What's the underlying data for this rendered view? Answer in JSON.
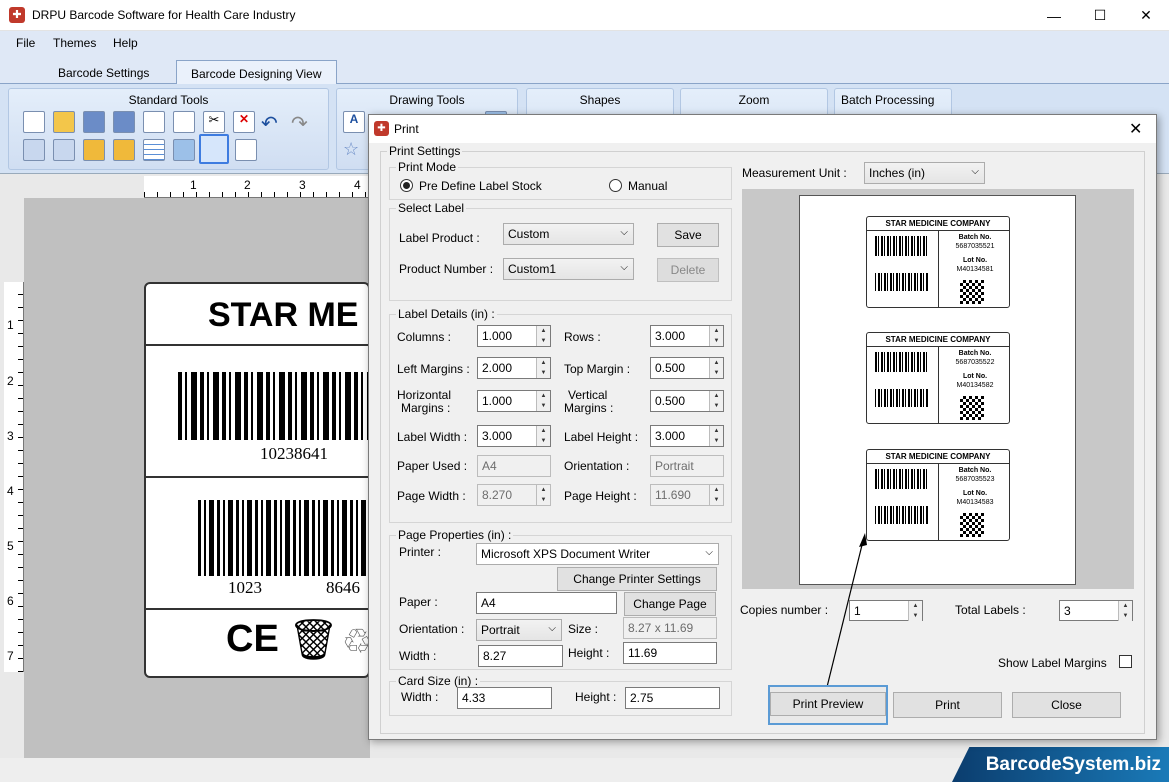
{
  "app": {
    "title": "DRPU Barcode Software for Health Care Industry"
  },
  "menu": [
    "File",
    "Themes",
    "Help"
  ],
  "tabs": [
    "Barcode Settings",
    "Barcode Designing View"
  ],
  "ribbon": {
    "groups": [
      "Standard Tools",
      "Drawing Tools",
      "Shapes",
      "Zoom",
      "Batch Processing"
    ]
  },
  "canvas": {
    "hruler": [
      "1",
      "2",
      "3",
      "4"
    ],
    "vruler": [
      "1",
      "2",
      "3",
      "4",
      "5",
      "6",
      "7"
    ],
    "label_title": "STAR ME",
    "barcode1": "10238641",
    "barcode2_left": "1023",
    "barcode2_right": "8646",
    "ce": "CE"
  },
  "brand": "BarcodeSystem.biz",
  "dialog": {
    "title": "Print",
    "print_settings": "Print Settings",
    "print_mode": {
      "legend": "Print Mode",
      "opt1": "Pre Define Label Stock",
      "opt2": "Manual"
    },
    "select_label": {
      "legend": "Select Label",
      "product_label": "Label Product :",
      "product_value": "Custom",
      "save": "Save",
      "number_label": "Product Number :",
      "number_value": "Custom1",
      "delete": "Delete"
    },
    "label_details": {
      "legend": "Label Details (in) :",
      "columns_l": "Columns :",
      "columns": "1.000",
      "rows_l": "Rows :",
      "rows": "3.000",
      "lmargin_l": "Left Margins :",
      "lmargin": "2.000",
      "tmargin_l": "Top Margin :",
      "tmargin": "0.500",
      "hmargin_l1": "Horizontal",
      "hmargin_l2": "Margins :",
      "hmargin": "1.000",
      "vmargin_l1": "Vertical",
      "vmargin_l2": "Margins :",
      "vmargin": "0.500",
      "lwidth_l": "Label Width :",
      "lwidth": "3.000",
      "lheight_l": "Label Height :",
      "lheight": "3.000",
      "paper_l": "Paper Used :",
      "paper": "A4",
      "orient_l": "Orientation :",
      "orient": "Portrait",
      "pwidth_l": "Page Width :",
      "pwidth": "8.270",
      "pheight_l": "Page Height :",
      "pheight": "11.690"
    },
    "page_props": {
      "legend": "Page Properties (in) :",
      "printer_l": "Printer :",
      "printer": "Microsoft XPS Document Writer",
      "change_printer": "Change Printer Settings",
      "paper_l": "Paper :",
      "paper": "A4",
      "change_page": "Change Page",
      "orient_l": "Orientation :",
      "orient": "Portrait",
      "size_l": "Size :",
      "size": "8.27 x 11.69",
      "width_l": "Width :",
      "width": "8.27",
      "height_l": "Height :",
      "height": "11.69"
    },
    "card_size": {
      "legend": "Card Size (in) :",
      "width_l": "Width :",
      "width": "4.33",
      "height_l": "Height :",
      "height": "2.75"
    },
    "measurement_l": "Measurement Unit :",
    "measurement": "Inches (in)",
    "copies_l": "Copies number :",
    "copies": "1",
    "total_l": "Total Labels :",
    "total": "3",
    "show_margins": "Show Label Margins",
    "buttons": {
      "preview": "Print Preview",
      "print": "Print",
      "close": "Close"
    },
    "preview_labels": [
      {
        "company": "STAR MEDICINE COMPANY",
        "batch_l": "Batch No.",
        "batch": "5687035521",
        "lot_l": "Lot No.",
        "lot": "M40134581"
      },
      {
        "company": "STAR MEDICINE COMPANY",
        "batch_l": "Batch No.",
        "batch": "5687035522",
        "lot_l": "Lot No.",
        "lot": "M40134582"
      },
      {
        "company": "STAR MEDICINE COMPANY",
        "batch_l": "Batch No.",
        "batch": "5687035523",
        "lot_l": "Lot No.",
        "lot": "M40134583"
      }
    ]
  }
}
